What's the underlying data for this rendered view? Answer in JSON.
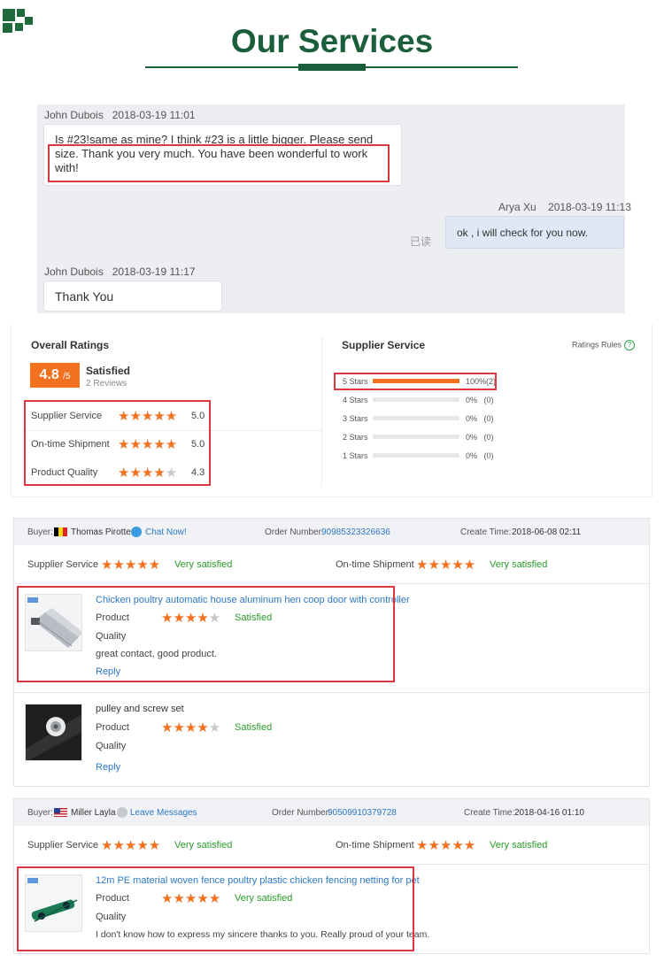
{
  "header": {
    "title": "Our Services"
  },
  "chat": {
    "messages": [
      {
        "author": "John Dubois",
        "time": "2018-03-19 11:01",
        "text": "Is #23!same as mine? I think #23 is a little bigger. Please send size. Thank you very much. You have been wonderful to work with!"
      },
      {
        "author": "Arya Xu",
        "time": "2018-03-19 11:13",
        "text": "ok , i will check for you now.",
        "status": "已读"
      },
      {
        "author": "John Dubois",
        "time": "2018-03-19 11:17",
        "text": "Thank You"
      }
    ]
  },
  "overall": {
    "heading": "Overall Ratings",
    "score": "4.8",
    "score_max": "/5",
    "label": "Satisfied",
    "reviews": "2 Reviews",
    "items": [
      {
        "label": "Supplier Service",
        "value": "5.0",
        "stars": 5
      },
      {
        "label": "On-time Shipment",
        "value": "5.0",
        "stars": 5
      },
      {
        "label": "Product Quality",
        "value": "4.3",
        "stars": 4.3
      }
    ]
  },
  "supplier_service": {
    "heading": "Supplier Service",
    "rules_label": "Ratings Rules",
    "rows": [
      {
        "label": "5 Stars",
        "percent": "100%",
        "count": "(2)",
        "fill": 1.0
      },
      {
        "label": "4 Stars",
        "percent": "0%",
        "count": "(0)",
        "fill": 0
      },
      {
        "label": "3 Stars",
        "percent": "0%",
        "count": "(0)",
        "fill": 0
      },
      {
        "label": "2 Stars",
        "percent": "0%",
        "count": "(0)",
        "fill": 0
      },
      {
        "label": "1 Stars",
        "percent": "0%",
        "count": "(0)",
        "fill": 0
      }
    ]
  },
  "reviews": [
    {
      "buyer_label": "Buyer:",
      "buyer": "Thomas Pirotte",
      "contact": "Chat Now!",
      "order_label": "Order Number:",
      "order": "90985323326636",
      "created_label": "Create Time:",
      "created": "2018-06-08 02:11",
      "supplier_service": {
        "label": "Supplier Service",
        "rating": "Very satisfied",
        "stars": 5
      },
      "shipment": {
        "label": "On-time Shipment",
        "rating": "Very satisfied",
        "stars": 5
      },
      "products": [
        {
          "name": "Chicken poultry automatic house aluminum hen coop door with controller",
          "quality_label_1": "Product",
          "quality_label_2": "Quality",
          "rating": "Satisfied",
          "stars": 4,
          "comment": "great contact, good product.",
          "reply": "Reply"
        },
        {
          "name": "pulley and screw set",
          "quality_label_1": "Product",
          "quality_label_2": "Quality",
          "rating": "Satisfied",
          "stars": 4,
          "comment": "",
          "reply": "Reply"
        }
      ]
    },
    {
      "buyer_label": "Buyer:",
      "buyer": "Miller Layla",
      "contact": "Leave Messages",
      "order_label": "Order Number:",
      "order": "90509910379728",
      "created_label": "Create Time:",
      "created": "2018-04-16 01:10",
      "supplier_service": {
        "label": "Supplier Service",
        "rating": "Very satisfied",
        "stars": 5
      },
      "shipment": {
        "label": "On-time Shipment",
        "rating": "Very satisfied",
        "stars": 5
      },
      "products": [
        {
          "name": "12m PE material woven fence poultry plastic chicken fencing netting for pet",
          "quality_label_1": "Product",
          "quality_label_2": "Quality",
          "rating": "Very satisfied",
          "stars": 5,
          "comment": "I don't know how to express my sincere thanks to you. Really proud of your team.",
          "reply": ""
        }
      ]
    }
  ],
  "colors": {
    "brand_green": "#1b5e3b",
    "accent_orange": "#f2701e",
    "highlight_red": "#d9383f",
    "link_blue": "#2d78c4",
    "ok_green": "#2a9b2a"
  }
}
